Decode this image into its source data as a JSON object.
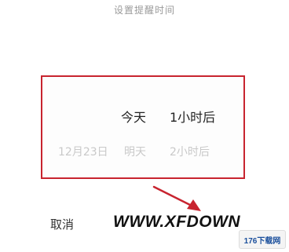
{
  "dialog": {
    "title": "设置提醒时间",
    "cancel_label": "取消"
  },
  "picker": {
    "selected": {
      "day": "今天",
      "time": "1小时后"
    },
    "next": {
      "date": "12月23日",
      "day": "明天",
      "time": "2小时后"
    }
  },
  "overlay": {
    "watermark_text": "WWW.XFDOWN",
    "logo_text": "176下载网",
    "highlight_color": "#c8242f"
  }
}
